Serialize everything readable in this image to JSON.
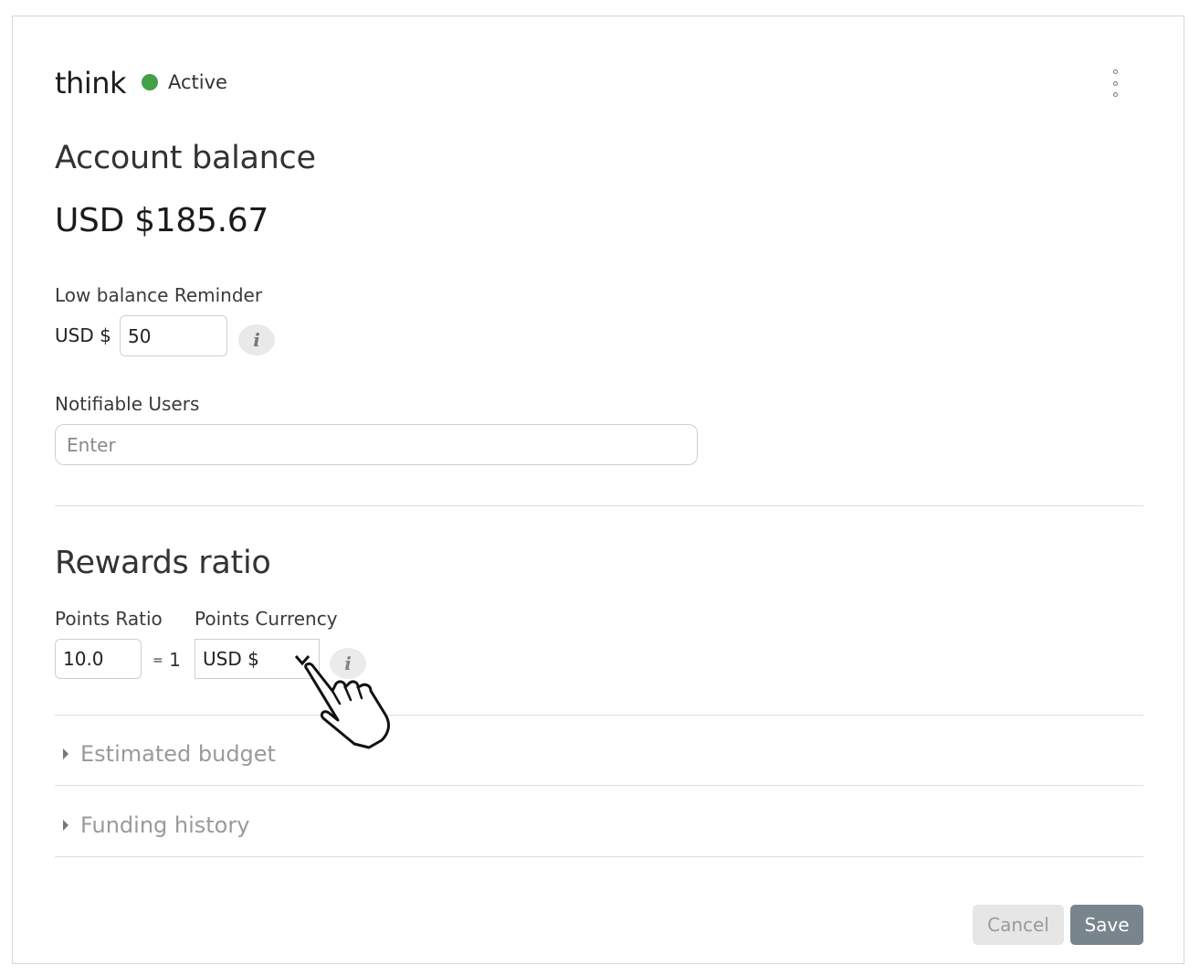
{
  "header": {
    "title": "think",
    "status": "Active",
    "status_color": "#43a047",
    "menu_icon": "kebab-menu-icon"
  },
  "balance": {
    "heading": "Account balance",
    "value": "USD $185.67"
  },
  "low_balance": {
    "label": "Low balance Reminder",
    "prefix": "USD $",
    "value": "50",
    "info_icon": "i"
  },
  "notifiable_users": {
    "label": "Notifiable Users",
    "placeholder": "Enter"
  },
  "rewards": {
    "heading": "Rewards ratio",
    "points_ratio_label": "Points Ratio",
    "points_currency_label": "Points Currency",
    "points_ratio_value": "10.0",
    "equals_sign": "=",
    "equals_value": "1",
    "currency_selected": "USD $",
    "info_icon": "i"
  },
  "accordions": [
    {
      "label": "Estimated budget"
    },
    {
      "label": "Funding history"
    }
  ],
  "footer": {
    "cancel_label": "Cancel",
    "save_label": "Save",
    "save_color": "#78858c"
  }
}
